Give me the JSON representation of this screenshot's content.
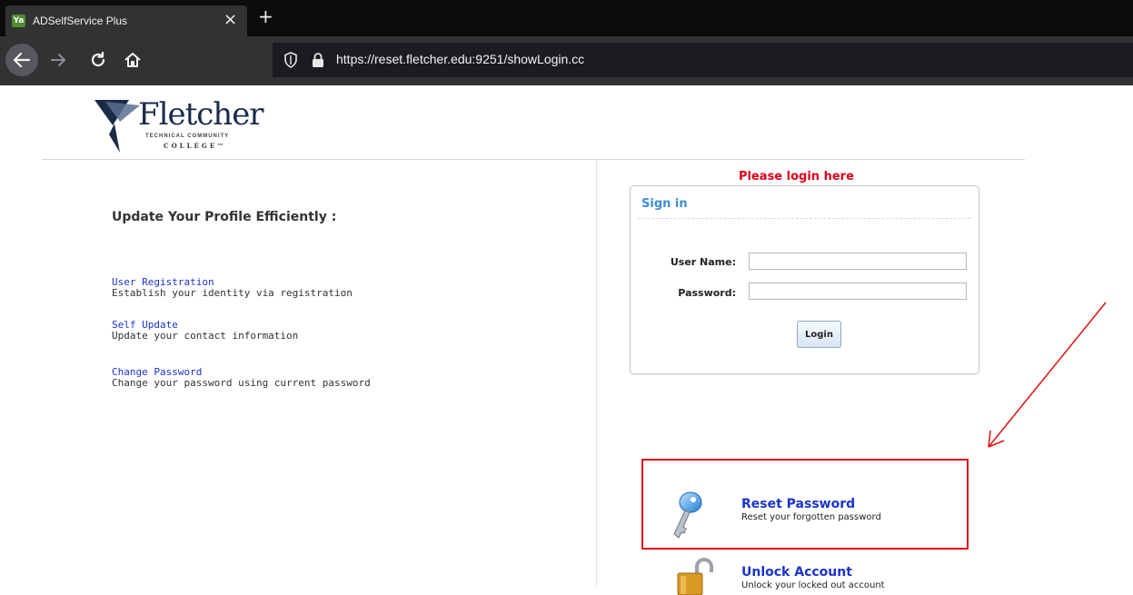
{
  "browser": {
    "tab_title": "ADSelfService Plus",
    "tab_favicon_text": "Ya",
    "tab_close_glyph": "×",
    "new_tab_glyph": "+",
    "url": "https://reset.fletcher.edu:9251/showLogin.cc",
    "icons": [
      "back-icon",
      "forward-icon",
      "reload-icon",
      "home-icon",
      "shield-icon",
      "lock-icon"
    ]
  },
  "logo": {
    "name": "Fletcher",
    "subtitle1": "TECHNICAL COMMUNITY",
    "subtitle2": "COLLEGE™"
  },
  "left": {
    "heading": "Update Your Profile Efficiently :",
    "features": [
      {
        "link": "User Registration",
        "desc": "Establish your identity via registration"
      },
      {
        "link": "Self Update",
        "desc": "Update your contact information"
      },
      {
        "link": "Change Password",
        "desc": "Change your password using current password"
      }
    ]
  },
  "login": {
    "prompt": "Please login here",
    "box_title": "Sign in",
    "username_label": "User Name:",
    "password_label": "Password:",
    "username_value": "",
    "password_value": "",
    "button_label": "Login"
  },
  "actions": [
    {
      "title": "Reset Password",
      "desc": "Reset your forgotten password"
    },
    {
      "title": "Unlock Account",
      "desc": "Unlock your locked out account"
    }
  ],
  "colors": {
    "accent_red": "#e0001b",
    "link_blue": "#1a33cc",
    "signin_blue": "#3b8fd6",
    "highlight_red": "#e01010"
  }
}
